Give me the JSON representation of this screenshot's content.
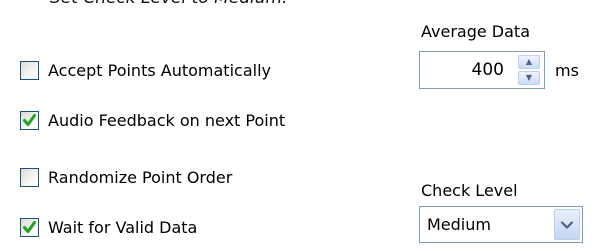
{
  "heading": "Set Check Level to Medium.",
  "options": {
    "accept_points": {
      "label": "Accept Points Automatically",
      "checked": false
    },
    "audio_feedback": {
      "label": "Audio Feedback on next Point",
      "checked": true
    },
    "randomize": {
      "label": "Randomize Point Order",
      "checked": false
    },
    "wait_valid": {
      "label": "Wait for Valid Data",
      "checked": true
    }
  },
  "average_data": {
    "label": "Average Data",
    "value": "400",
    "unit": "ms",
    "up_icon": "spin-up-icon",
    "down_icon": "spin-down-icon"
  },
  "check_level": {
    "label": "Check Level",
    "value": "Medium",
    "icon": "chevron-down-icon"
  },
  "colors": {
    "accent": "#21a121",
    "border": "#7f9db9",
    "checkbox_border": "#1c5180"
  }
}
